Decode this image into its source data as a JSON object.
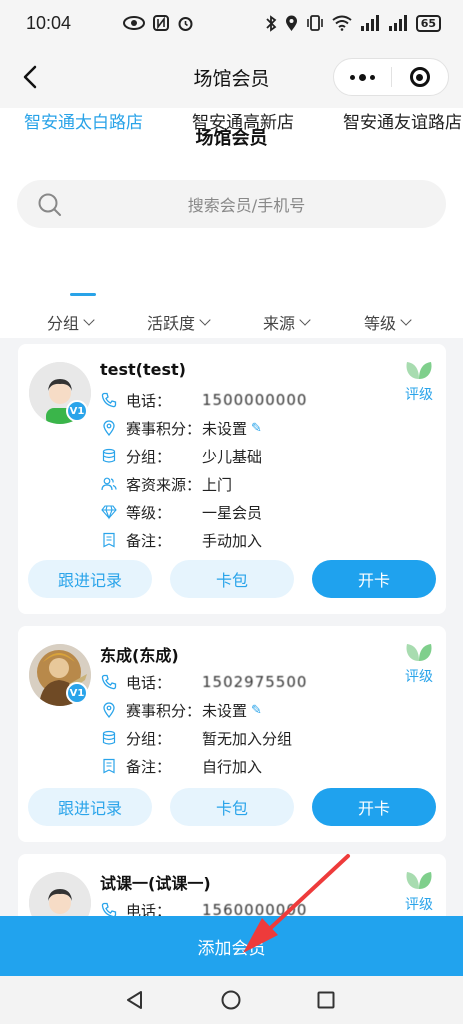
{
  "status_bar": {
    "time": "10:04",
    "battery": "65"
  },
  "nav": {
    "title": "场馆会员"
  },
  "page": {
    "heading": "场馆会员"
  },
  "search": {
    "placeholder": "搜索会员/手机号"
  },
  "store_tabs": [
    {
      "label": "智安通太白路店",
      "active": true
    },
    {
      "label": "智安通高新店",
      "active": false
    },
    {
      "label": "智安通友谊路店",
      "active": false
    }
  ],
  "filters": [
    "分组",
    "活跃度",
    "来源",
    "等级"
  ],
  "members": [
    {
      "name": "test(test)",
      "level_badge": "V1",
      "rating_label": "评级",
      "fields": [
        {
          "label": "电话：",
          "value": "1500000000"
        },
        {
          "label": "赛事积分：",
          "value": "未设置"
        },
        {
          "label": "分组：",
          "value": "少儿基础"
        },
        {
          "label": "客资来源：",
          "value": "上门"
        },
        {
          "label": "等级：",
          "value": "一星会员"
        },
        {
          "label": "备注：",
          "value": "手动加入"
        }
      ],
      "buttons": {
        "follow": "跟进记录",
        "wallet": "卡包",
        "open": "开卡"
      }
    },
    {
      "name": "东成(东成)",
      "level_badge": "V1",
      "rating_label": "评级",
      "fields": [
        {
          "label": "电话：",
          "value": "1502975500"
        },
        {
          "label": "赛事积分：",
          "value": "未设置"
        },
        {
          "label": "分组：",
          "value": "暂无加入分组"
        },
        {
          "label": "备注：",
          "value": "自行加入"
        }
      ],
      "buttons": {
        "follow": "跟进记录",
        "wallet": "卡包",
        "open": "开卡"
      }
    },
    {
      "name": "试课一(试课一)",
      "rating_label": "评级",
      "fields": [
        {
          "label": "电话：",
          "value": "1560000000"
        }
      ]
    }
  ],
  "bottom": {
    "add_button": "添加会员"
  },
  "colors": {
    "accent": "#21a3ee",
    "accent_light": "#e6f4fd",
    "rating_green": "#a8dcb0",
    "annotation_arrow": "#ee3b3b"
  }
}
